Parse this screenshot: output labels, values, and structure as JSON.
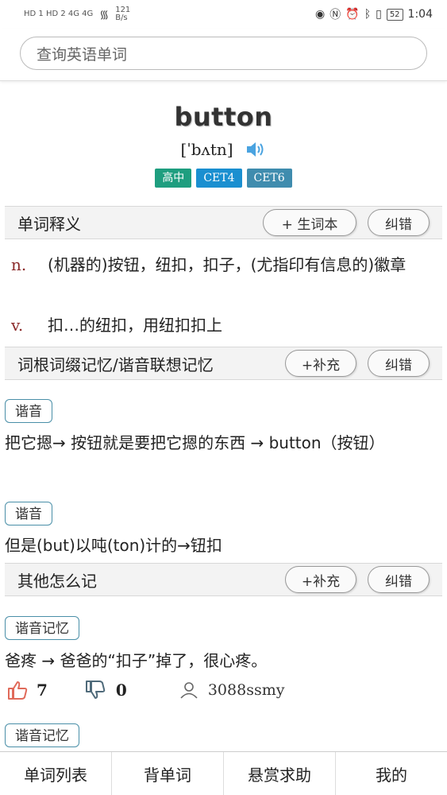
{
  "status": {
    "signal_left": "HD 1 HD 2  4G  4G",
    "speed_value": "121",
    "speed_unit": "B/s",
    "battery": "52",
    "time": "1:04"
  },
  "search": {
    "placeholder": "查询英语单词"
  },
  "word": {
    "text": "button",
    "phonetic": "[ˈbʌtn]",
    "tags": [
      {
        "label": "高中",
        "color": "#1e9e7f"
      },
      {
        "label": "CET4",
        "color": "#1a8fd0"
      },
      {
        "label": "CET6",
        "color": "#3f8cae"
      }
    ]
  },
  "definition_section": {
    "title": "单词释义",
    "add_btn": "+ 生词本",
    "correct_btn": "纠错",
    "defs": [
      {
        "pos": "n.",
        "text": "(机器的)按钮，纽扣，扣子，(尤指印有信息的)徽章"
      },
      {
        "pos": "v.",
        "text": "扣…的纽扣，用纽扣扣上"
      }
    ]
  },
  "root_section": {
    "title": "词根词缀记忆/谐音联想记忆",
    "add_btn": "+补充",
    "correct_btn": "纠错",
    "items": [
      {
        "chip": "谐音",
        "text": "把它摁→ 按钮就是要把它摁的东西 → button（按钮）"
      },
      {
        "chip": "谐音",
        "text": "但是(but)以吨(ton)计的→钮扣"
      }
    ]
  },
  "other_section": {
    "title": "其他怎么记",
    "add_btn": "+补充",
    "correct_btn": "纠错",
    "items": [
      {
        "chip": "谐音记忆",
        "text": "爸疼 → 爸爸的“扣子”掉了，很心疼。",
        "likes": "7",
        "dislikes": "0",
        "user": "3088ssmy"
      },
      {
        "chip": "谐音记忆"
      }
    ]
  },
  "bottom_nav": [
    "单词列表",
    "背单词",
    "悬赏求助",
    "我的"
  ],
  "colors": {
    "pos": "#8b2a2a",
    "chip_border": "#4a8fa8",
    "speaker": "#4aa3e0"
  }
}
